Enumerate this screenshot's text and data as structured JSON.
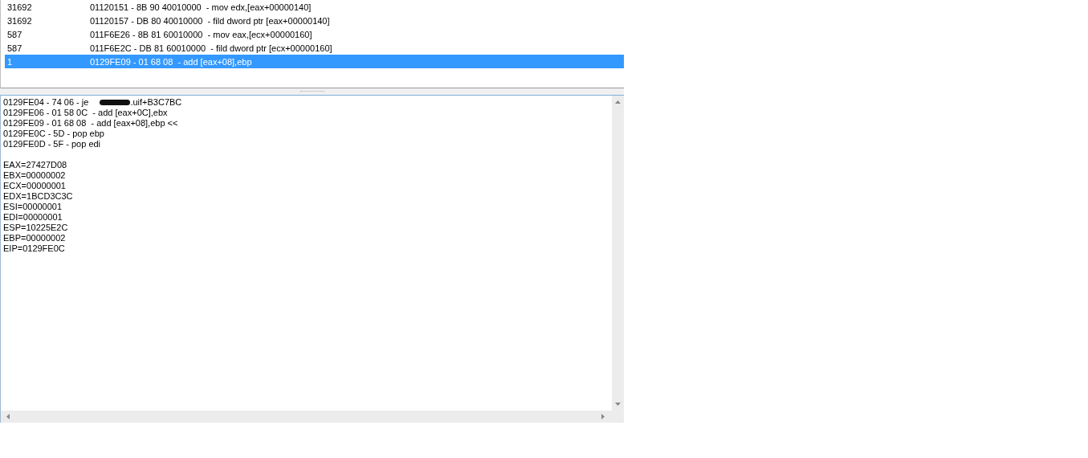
{
  "results_list": {
    "rows": [
      {
        "count": "31692",
        "instruction": "01120151 - 8B 90 40010000  - mov edx,[eax+00000140]",
        "selected": false
      },
      {
        "count": "31692",
        "instruction": "01120157 - DB 80 40010000  - fild dword ptr [eax+00000140]",
        "selected": false
      },
      {
        "count": "587",
        "instruction": "011F6E26 - 8B 81 60010000  - mov eax,[ecx+00000160]",
        "selected": false
      },
      {
        "count": "587",
        "instruction": "011F6E2C - DB 81 60010000  - fild dword ptr [ecx+00000160]",
        "selected": false
      },
      {
        "count": "1",
        "instruction": "0129FE09 - 01 68 08  - add [eax+08],ebp",
        "selected": true
      }
    ]
  },
  "details": {
    "code_lines": [
      {
        "kind": "redacted",
        "before": "0129FE04 - 74 06 - je",
        "after": ".uif+B3C7BC"
      },
      {
        "kind": "plain",
        "text": "0129FE06 - 01 58 0C  - add [eax+0C],ebx"
      },
      {
        "kind": "plain",
        "text": "0129FE09 - 01 68 08  - add [eax+08],ebp <<"
      },
      {
        "kind": "plain",
        "text": "0129FE0C - 5D - pop ebp"
      },
      {
        "kind": "plain",
        "text": "0129FE0D - 5F - pop edi"
      }
    ],
    "registers": [
      "EAX=27427D08",
      "EBX=00000002",
      "ECX=00000001",
      "EDX=1BCD3C3C",
      "ESI=00000001",
      "EDI=00000001",
      "ESP=10225E2C",
      "EBP=00000002",
      "EIP=0129FE0C"
    ]
  }
}
